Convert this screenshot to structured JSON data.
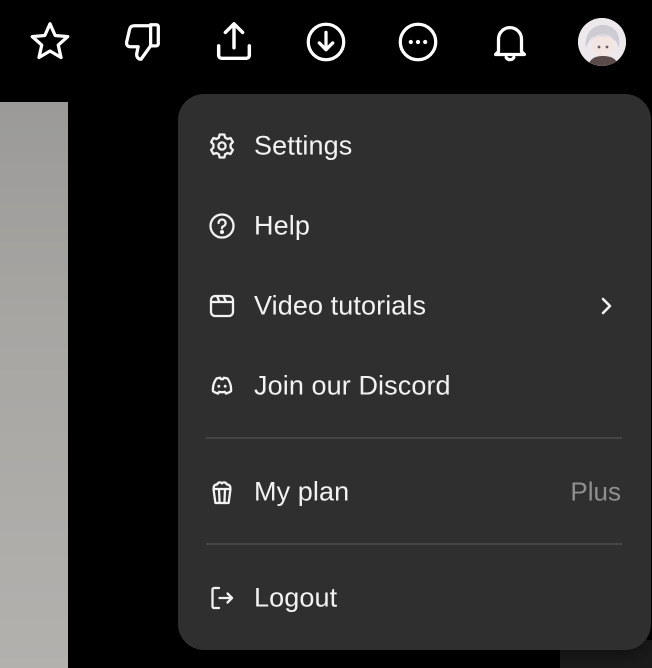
{
  "toolbar": {
    "icons": [
      {
        "name": "star-icon"
      },
      {
        "name": "thumbs-down-icon"
      },
      {
        "name": "share-upload-icon"
      },
      {
        "name": "download-icon"
      },
      {
        "name": "more-options-icon"
      },
      {
        "name": "notification-bell-icon"
      }
    ],
    "avatar": "user-avatar"
  },
  "menu": {
    "items": [
      {
        "label": "Settings",
        "icon": "gear-icon"
      },
      {
        "label": "Help",
        "icon": "question-circle-icon"
      },
      {
        "label": "Video tutorials",
        "icon": "clapperboard-icon",
        "submenu": true
      },
      {
        "label": "Join our Discord",
        "icon": "discord-icon"
      },
      {
        "label": "My plan",
        "icon": "popcorn-bucket-icon",
        "value": "Plus"
      },
      {
        "label": "Logout",
        "icon": "logout-icon"
      }
    ]
  },
  "colors": {
    "background": "#000000",
    "menu_bg": "#2f2f2f",
    "menu_text": "#f2f2f2",
    "muted_text": "#8f8f8f",
    "divider": "#454545"
  }
}
